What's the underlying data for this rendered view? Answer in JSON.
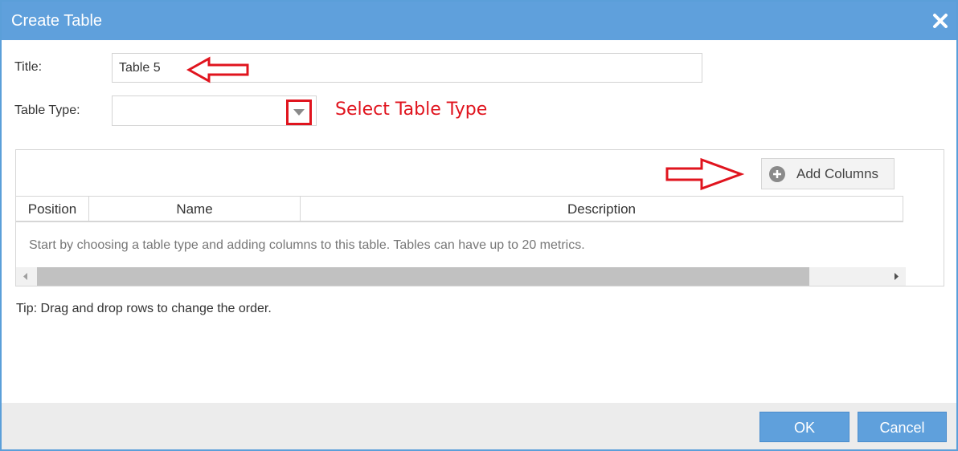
{
  "dialog": {
    "title": "Create Table",
    "close_icon": "close-icon"
  },
  "form": {
    "title_label": "Title:",
    "title_value": "Table 5",
    "table_type_label": "Table Type:",
    "table_type_value": ""
  },
  "annotations": {
    "select_table_type": "Select Table Type",
    "arrow_color": "#e0141e"
  },
  "grid": {
    "add_columns_label": "Add Columns",
    "add_columns_icon": "plus-circle-icon",
    "columns": [
      "Position",
      "Name",
      "Description"
    ],
    "empty_message": "Start by choosing a table type and adding columns to this table. Tables can have up to 20 metrics."
  },
  "tip": "Tip: Drag and drop rows to change the order.",
  "footer": {
    "ok_label": "OK",
    "cancel_label": "Cancel"
  },
  "colors": {
    "accent": "#5fa0dc",
    "annotation": "#e0141e",
    "footer_bg": "#ececec"
  }
}
